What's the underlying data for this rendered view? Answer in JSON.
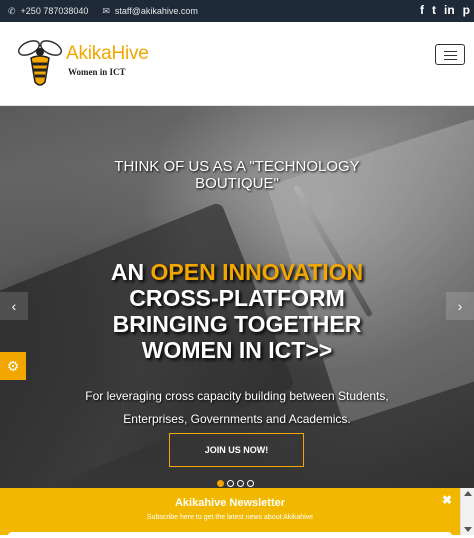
{
  "topbar": {
    "phone": "+250 787038040",
    "email": "staff@akikahive.com",
    "social_icons": [
      "facebook-icon",
      "twitter-icon",
      "linkedin-icon",
      "pinterest-icon"
    ],
    "social_glyphs": [
      "f",
      "t",
      "in",
      "p"
    ]
  },
  "header": {
    "brand": "AkikaHive",
    "tagline": "Women in ICT"
  },
  "hero": {
    "tagline": "THINK OF US AS A \"TECHNOLOGY BOUTIQUE\"",
    "headline_prefix": "AN",
    "headline_accent": "OPEN INNOVATION",
    "headline_line2": "CROSS-PLATFORM",
    "headline_line3": "BRINGING TOGETHER",
    "headline_line4": "WOMEN IN ICT>>",
    "subtext_line1": "For leveraging cross capacity building between Students,",
    "subtext_line2": "Enterprises, Governments and Academics.",
    "cta_label": "JOIN US NOW!",
    "slide_count": 4,
    "active_slide": 1,
    "prev_glyph": "‹",
    "next_glyph": "›"
  },
  "newsletter": {
    "title": "Akikahive Newsletter",
    "subtitle": "Subscribe here to get the latest news about Akikahive",
    "close_glyph": "✖"
  },
  "colors": {
    "accent": "#f2a600",
    "topbar_bg": "#1f2a38",
    "newsletter_bg": "#f2b800"
  }
}
